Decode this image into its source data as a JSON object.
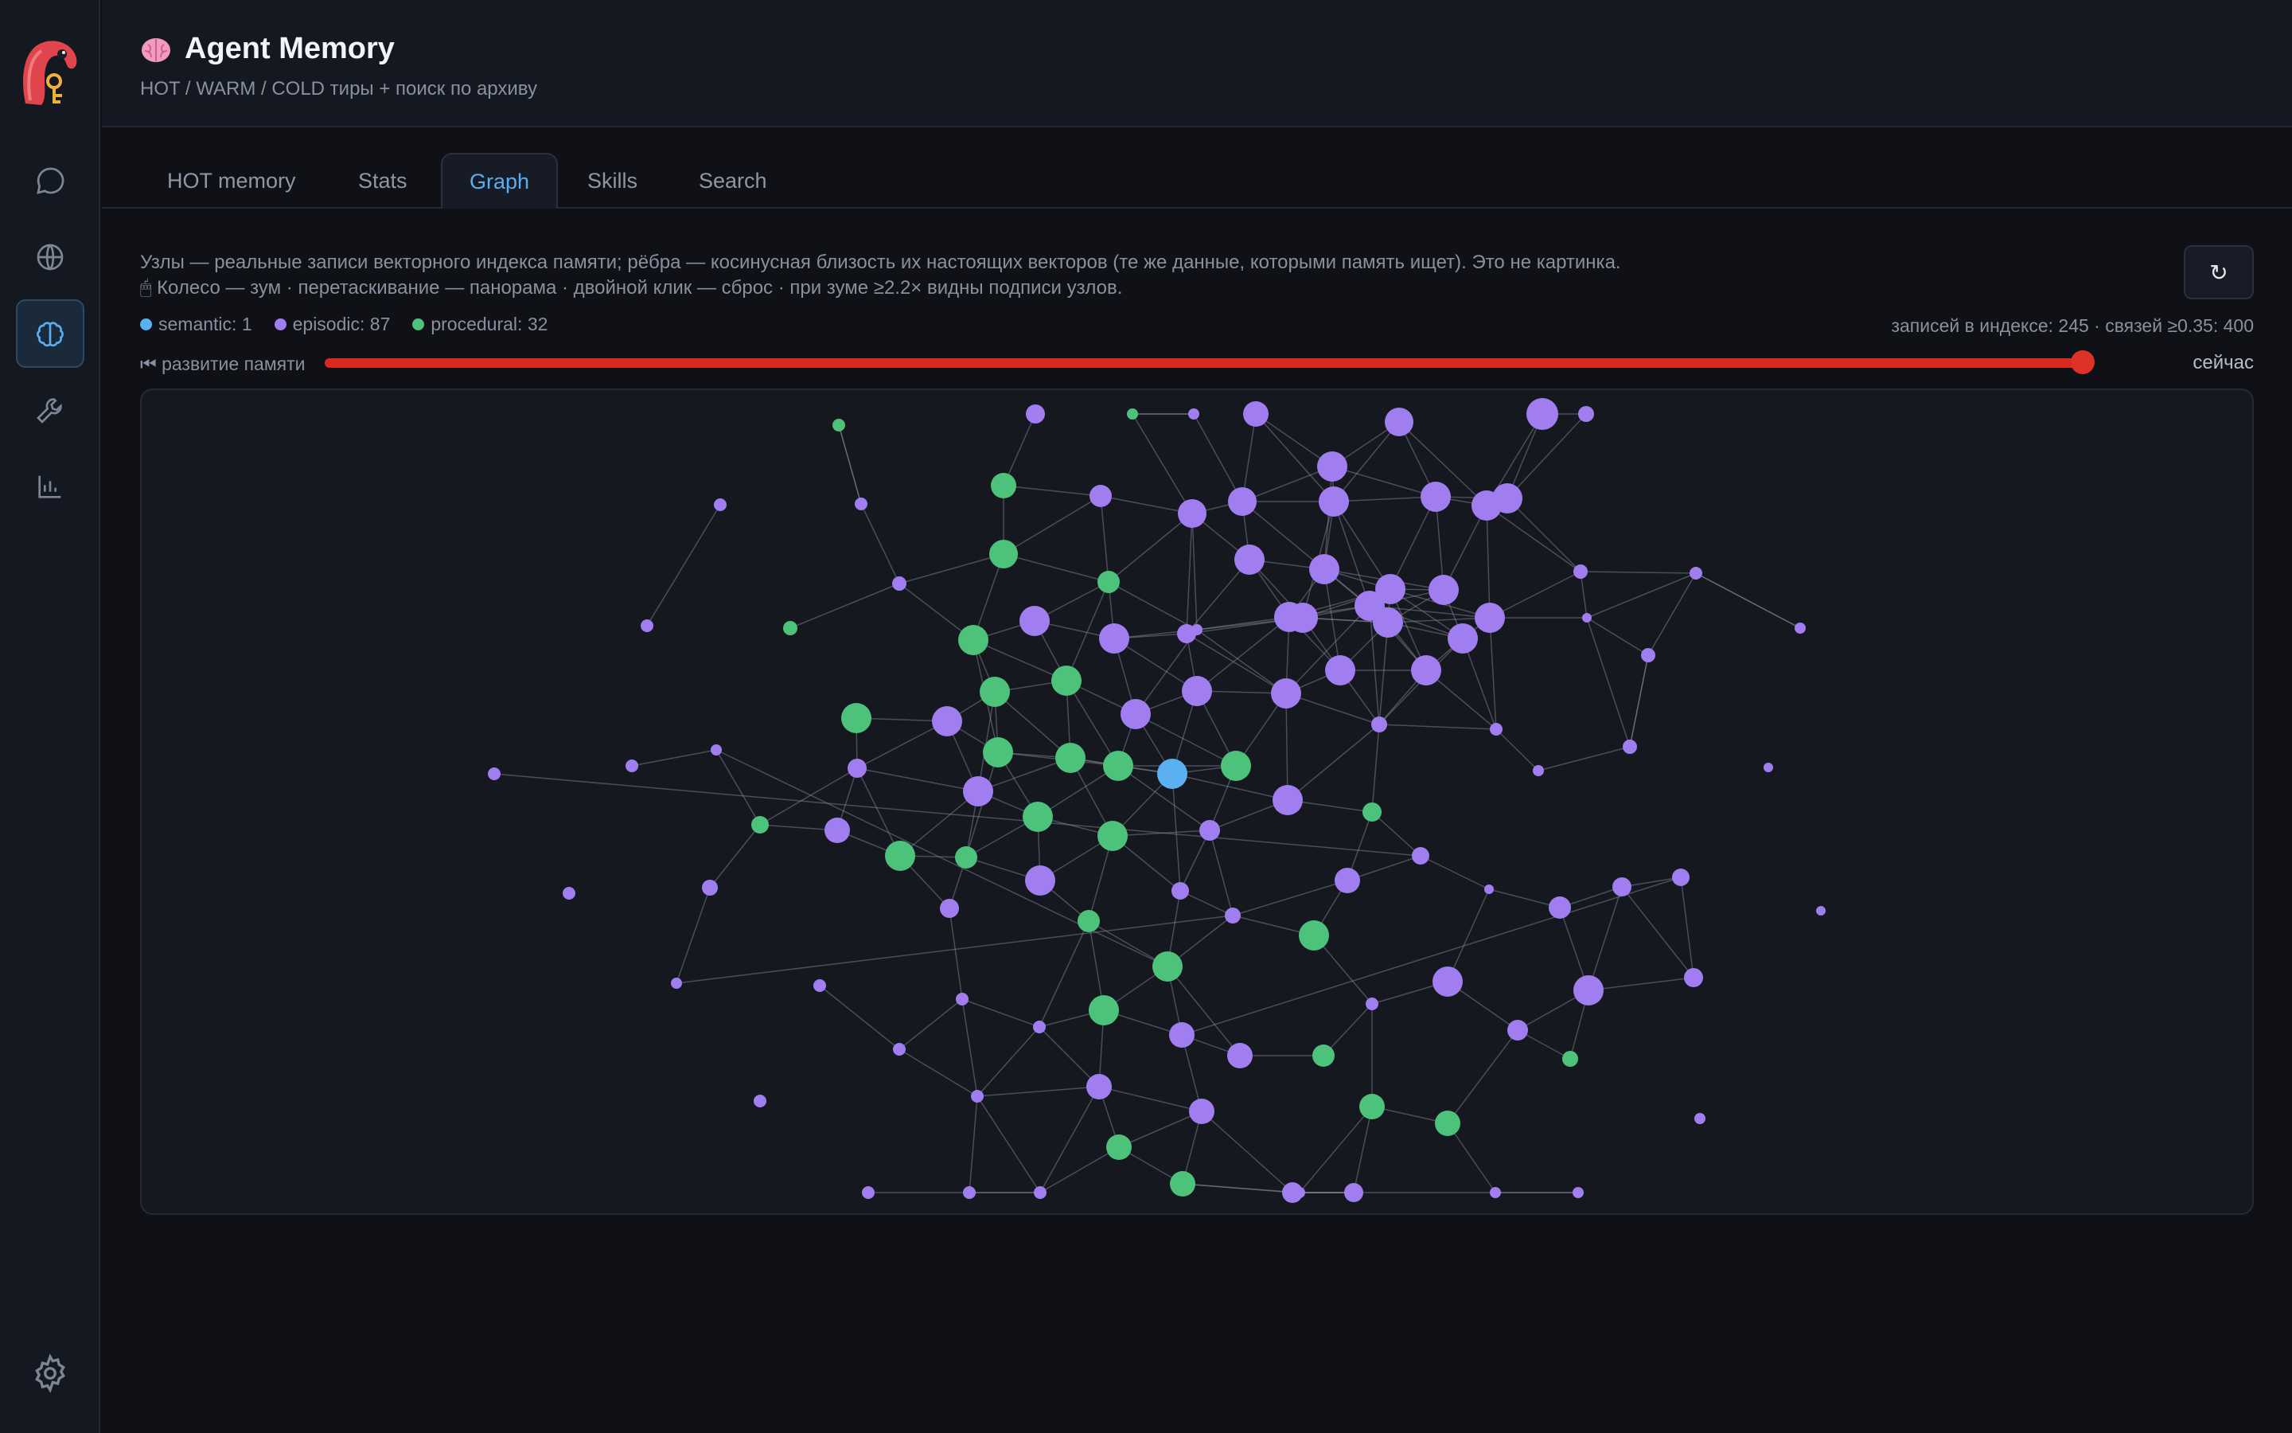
{
  "header": {
    "title": "Agent Memory",
    "subtitle": "HOT / WARM / COLD тиры + поиск по архиву"
  },
  "sidebar": {
    "items": [
      {
        "name": "chat",
        "icon": "chat-bubble-icon"
      },
      {
        "name": "web",
        "icon": "globe-icon"
      },
      {
        "name": "memory",
        "icon": "brain-icon",
        "active": true
      },
      {
        "name": "tools",
        "icon": "wrench-icon"
      },
      {
        "name": "analytics",
        "icon": "bar-chart-icon"
      }
    ],
    "settings_icon": "gear-icon"
  },
  "tabs": [
    "HOT memory",
    "Stats",
    "Graph",
    "Skills",
    "Search"
  ],
  "active_tab": "Graph",
  "graph": {
    "desc_line1": "Узлы — реальные записи векторного индекса памяти; рёбра — косинусная близость их настоящих векторов (те же данные, которыми память ищет). Это не картинка.",
    "desc_line2": "🖱 Колесо — зум · перетаскивание — панорама · двойной клик — сброс · при зуме ≥2.2× видны подписи узлов.",
    "legend": [
      {
        "label": "semantic: 1",
        "color": "#5ab0f0"
      },
      {
        "label": "episodic: 87",
        "color": "#a07ef0"
      },
      {
        "label": "procedural: 32",
        "color": "#4cc27a"
      }
    ],
    "stats": "записей в индексе: 245 · связей ≥0.35: 400",
    "timeline_label": "⏮ развитие памяти",
    "timeline_value": 1.0,
    "now_label": "сейчас",
    "refresh_label": "↻"
  },
  "colors": {
    "semantic": "#5ab0f0",
    "episodic": "#a07ef0",
    "procedural": "#4cc27a",
    "slider": "#d9281f",
    "accent": "#5aaef0"
  }
}
